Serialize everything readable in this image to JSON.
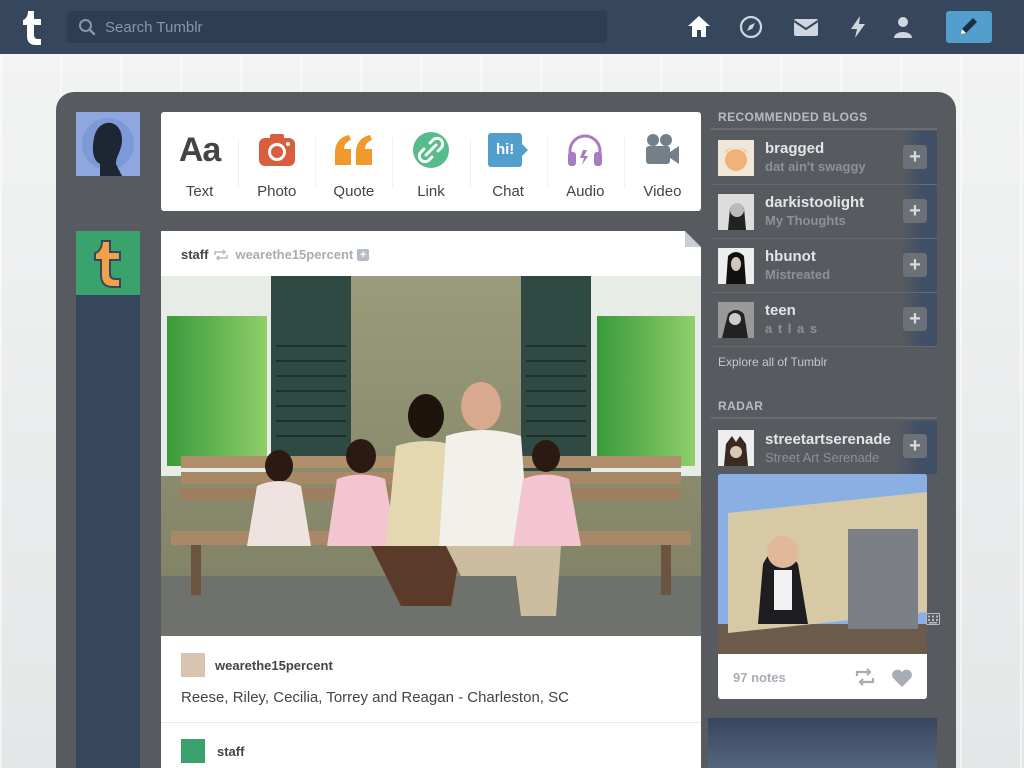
{
  "header": {
    "search_placeholder": "Search Tumblr",
    "nav_icons": [
      "home-icon",
      "explore-compass-icon",
      "inbox-mail-icon",
      "activity-lightning-icon",
      "account-user-icon"
    ],
    "compose_icon": "pencil-icon",
    "colors": {
      "bar": "#36465d",
      "compose": "#529ecc"
    }
  },
  "post_types": [
    {
      "label": "Text",
      "icon": "text-aa-icon",
      "color": "#444444"
    },
    {
      "label": "Photo",
      "icon": "camera-icon",
      "color": "#d95e40"
    },
    {
      "label": "Quote",
      "icon": "quote-icon",
      "color": "#f2992e"
    },
    {
      "label": "Link",
      "icon": "link-icon",
      "color": "#56bc8a"
    },
    {
      "label": "Chat",
      "icon": "chat-hi-icon",
      "color": "#529ecc"
    },
    {
      "label": "Audio",
      "icon": "headphones-icon",
      "color": "#a77dc2"
    },
    {
      "label": "Video",
      "icon": "video-camera-icon",
      "color": "#748089"
    }
  ],
  "chat_icon_text": "hi!",
  "post": {
    "author": "staff",
    "reblogged_from": "wearethe15percent",
    "source_name": "wearethe15percent",
    "caption": "Reese, Riley, Cecilia, Torrey and Reagan - Charleston, SC",
    "next_author": "staff"
  },
  "sidebar": {
    "recommended_title": "Recommended Blogs",
    "blogs": [
      {
        "name": "bragged",
        "subtitle": "dat ain't swaggy"
      },
      {
        "name": "darkistoolight",
        "subtitle": "My Thoughts"
      },
      {
        "name": "hbunot",
        "subtitle": "Mistreated"
      },
      {
        "name": "teen",
        "subtitle": "a t l a s"
      }
    ],
    "explore_link": "Explore all of Tumblr",
    "radar_title": "Radar",
    "radar_blog": {
      "name": "streetartserenade",
      "subtitle": "Street Art Serenade"
    },
    "radar_notes": "97 notes"
  }
}
